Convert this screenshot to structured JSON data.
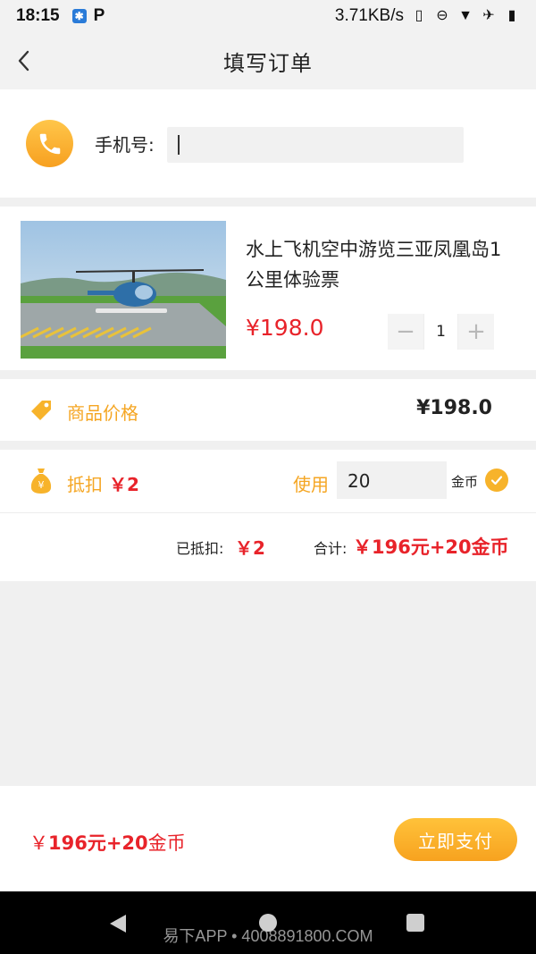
{
  "status_bar": {
    "time": "18:15",
    "network_speed": "3.71KB/s",
    "icons": [
      "app-notification-icon",
      "p-icon",
      "vibrate-icon",
      "dnd-icon",
      "wifi-icon",
      "airplane-icon",
      "battery-icon"
    ]
  },
  "header": {
    "title": "填写订单",
    "back_icon": "chevron-left-icon"
  },
  "phone": {
    "label": "手机号:",
    "value": "",
    "icon": "phone-icon"
  },
  "product": {
    "title": "水上飞机空中游览三亚凤凰岛1公里体验票",
    "price": "¥198.0",
    "quantity": "1",
    "minus": "−",
    "plus": "+",
    "image": "helicopter-photo"
  },
  "price_row": {
    "label": "商品价格",
    "value": "¥198.0",
    "icon": "tag-icon"
  },
  "deduction": {
    "label": "抵扣",
    "amount": "￥2",
    "use_label": "使用",
    "coins": "20",
    "coin_unit": "金币",
    "checked": true,
    "deducted_label": "已抵扣:",
    "deducted_value": "￥2",
    "total_label": "合计:",
    "total_value": "￥196元+20金币"
  },
  "footer": {
    "total_prefix": "￥",
    "total_amount": "196元+20",
    "total_suffix": "金币",
    "pay_label": "立即支付"
  },
  "nav": {
    "watermark": "易下APP • 4008891800.COM"
  },
  "colors": {
    "accent": "#f5a623",
    "price_red": "#e8232a",
    "background": "#f0f0f0"
  }
}
